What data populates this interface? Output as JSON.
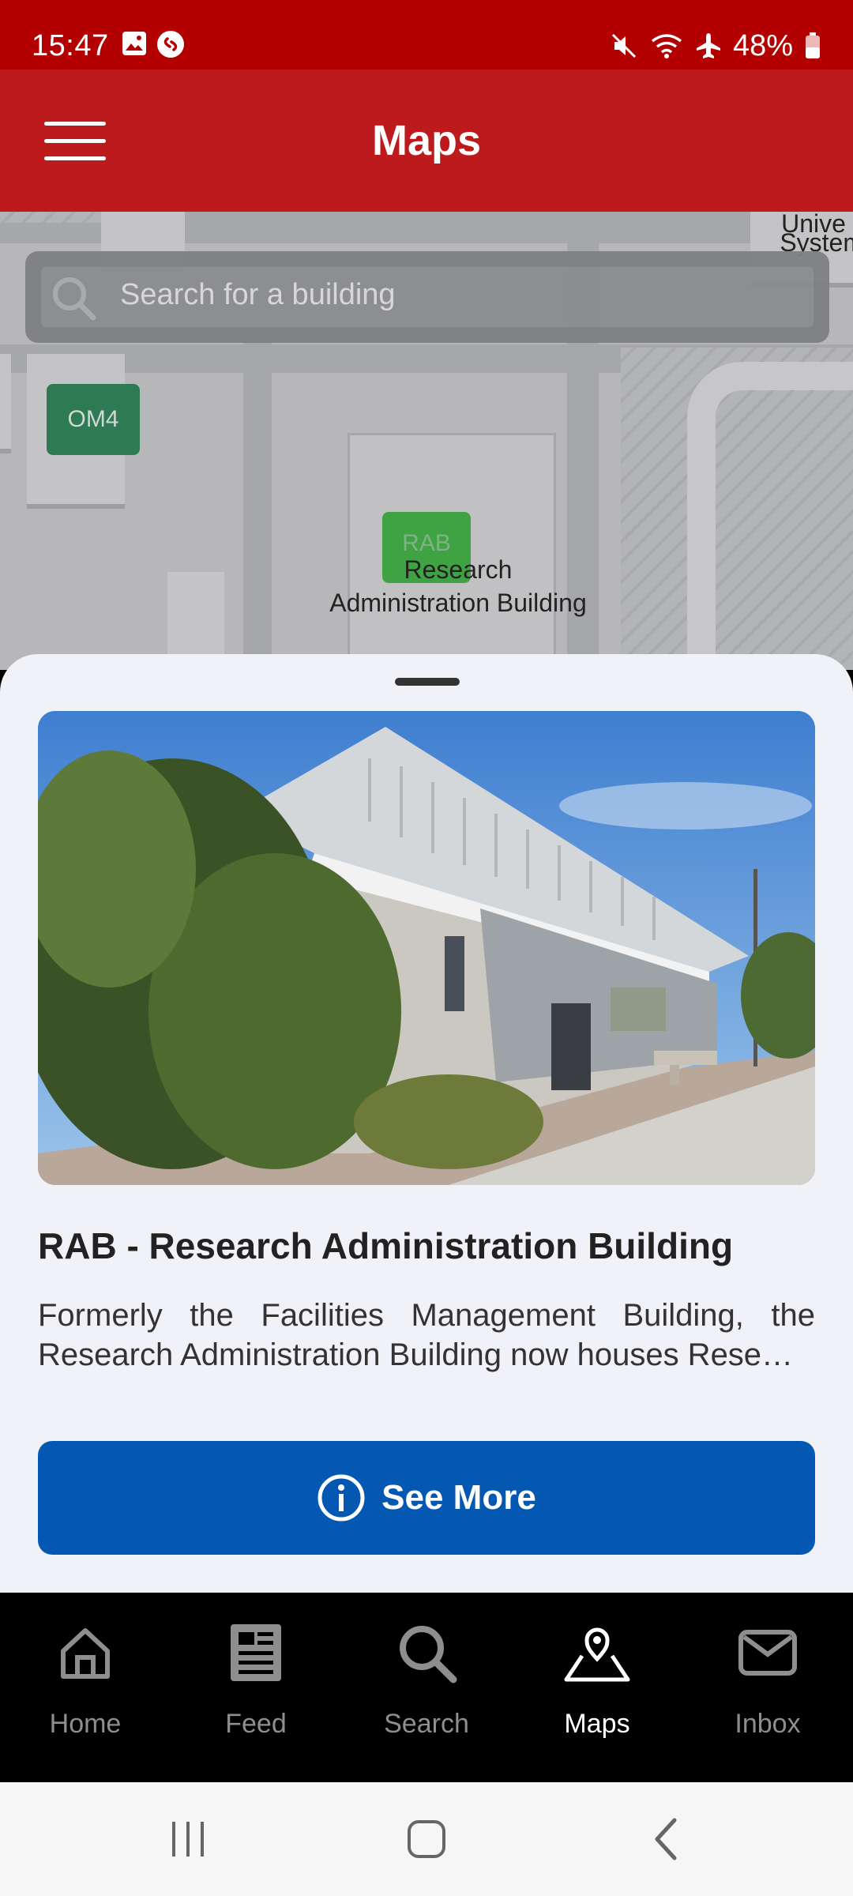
{
  "status_bar": {
    "time": "15:47",
    "battery": "48%"
  },
  "app_bar": {
    "title": "Maps"
  },
  "search": {
    "placeholder": "Search for a building"
  },
  "map": {
    "markers": [
      {
        "code": "OM4"
      },
      {
        "code": "RAB",
        "label_line1": "Research",
        "label_line2": "Administration Building"
      }
    ],
    "edge_label_top": "Unive",
    "edge_label": "Systems"
  },
  "building": {
    "name": "RAB - Research Administration Building",
    "description_line1": "Formerly the Facilities Management Building, the",
    "description_line2": "Research Administration Building now houses Rese…",
    "button_label": "See More"
  },
  "bottom_nav": {
    "items": [
      {
        "label": "Home",
        "icon": "home-icon"
      },
      {
        "label": "Feed",
        "icon": "feed-icon"
      },
      {
        "label": "Search",
        "icon": "search-icon"
      },
      {
        "label": "Maps",
        "icon": "map-icon",
        "active": true
      },
      {
        "label": "Inbox",
        "icon": "inbox-icon"
      }
    ]
  },
  "colors": {
    "header": "#bc1a1c",
    "status": "#b30000",
    "button": "#0558b2"
  }
}
